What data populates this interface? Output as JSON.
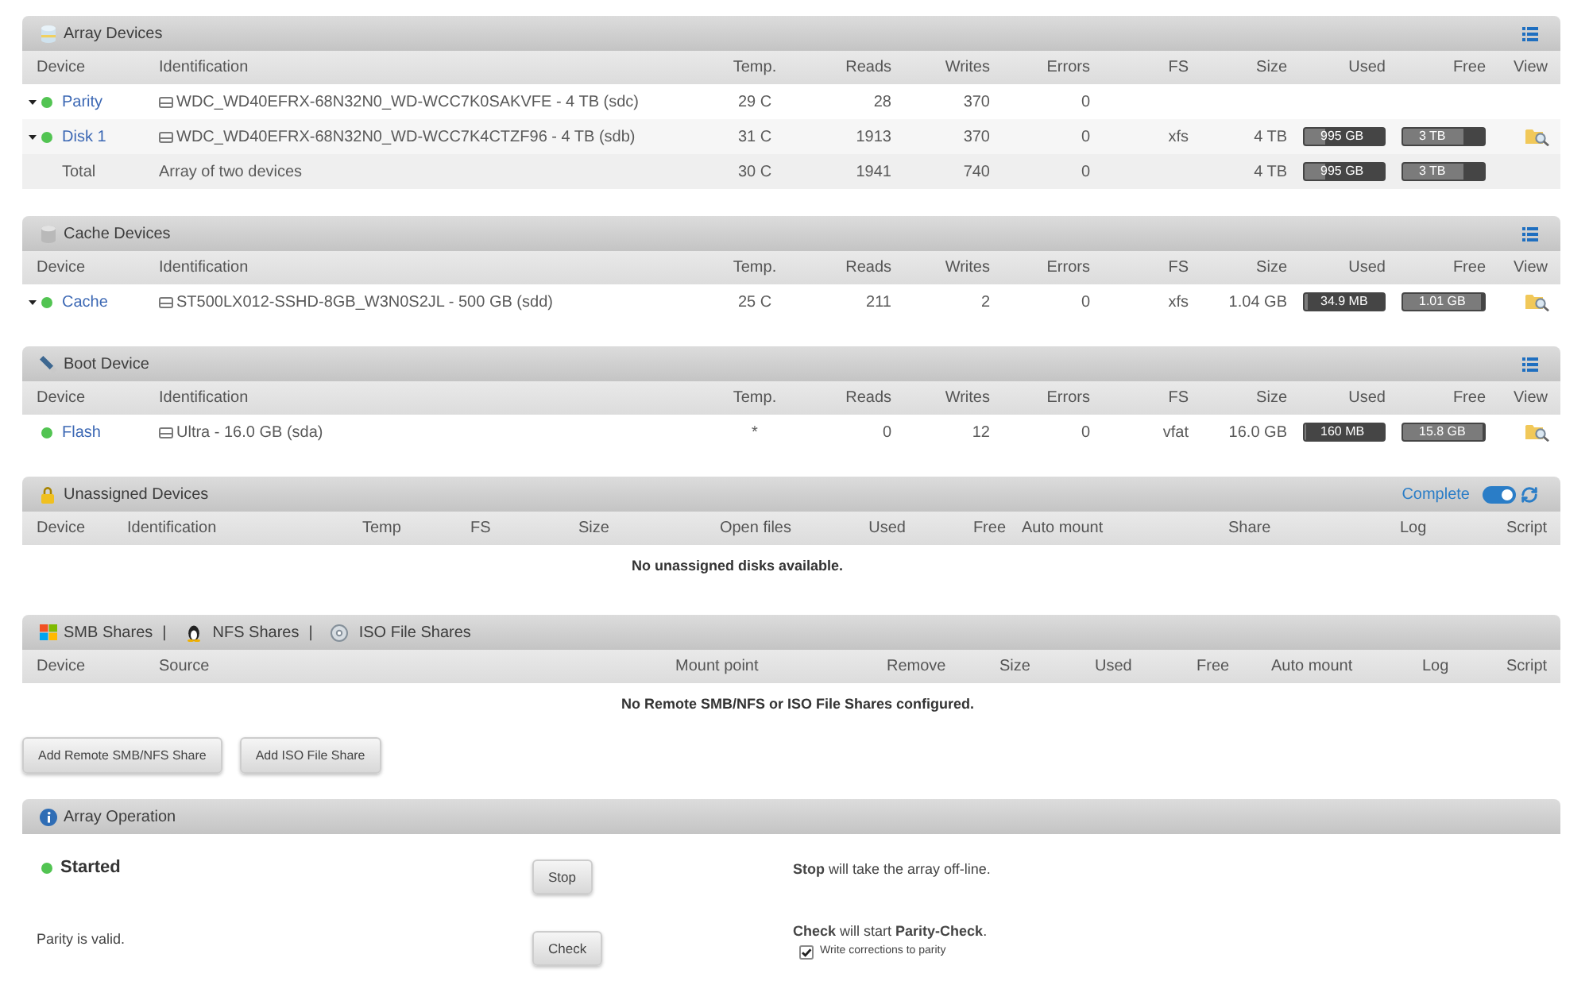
{
  "array_devices": {
    "title": "Array Devices",
    "columns": [
      "Device",
      "Identification",
      "Temp.",
      "Reads",
      "Writes",
      "Errors",
      "FS",
      "Size",
      "Used",
      "Free",
      "View"
    ],
    "rows": [
      {
        "kind": "device",
        "dropdown": true,
        "viewable": false,
        "name": "Parity",
        "identification": "WDC_WD40EFRX-68N32N0_WD-WCC7K0SAKVFE - 4 TB (sdc)",
        "temp": "29 C",
        "reads": "28",
        "writes": "370",
        "errors": "0"
      },
      {
        "kind": "device",
        "dropdown": true,
        "viewable": true,
        "name": "Disk 1",
        "identification": "WDC_WD40EFRX-68N32N0_WD-WCC7K4CTZF96 - 4 TB (sdb)",
        "temp": "31 C",
        "reads": "1913",
        "writes": "370",
        "errors": "0",
        "fs": "xfs",
        "size": "4 TB",
        "used": {
          "text": "995 GB",
          "level": 0.25
        },
        "free": {
          "text": "3 TB",
          "level": 0.75
        }
      },
      {
        "kind": "total",
        "dropdown": false,
        "viewable": false,
        "name": "Total",
        "identification": "Array of two devices",
        "temp": "30 C",
        "reads": "1941",
        "writes": "740",
        "errors": "0",
        "size": "4 TB",
        "used": {
          "text": "995 GB",
          "level": 0.25
        },
        "free": {
          "text": "3 TB",
          "level": 0.75
        }
      }
    ]
  },
  "cache_devices": {
    "title": "Cache Devices",
    "columns": [
      "Device",
      "Identification",
      "Temp.",
      "Reads",
      "Writes",
      "Errors",
      "FS",
      "Size",
      "Used",
      "Free",
      "View"
    ],
    "rows": [
      {
        "kind": "device",
        "dropdown": true,
        "viewable": true,
        "name": "Cache",
        "identification": "ST500LX012-SSHD-8GB_W3N0S2JL - 500 GB (sdd)",
        "temp": "25 C",
        "reads": "211",
        "writes": "2",
        "errors": "0",
        "fs": "xfs",
        "size": "1.04 GB",
        "used": {
          "text": "34.9 MB",
          "level": 0.03
        },
        "free": {
          "text": "1.01 GB",
          "level": 0.97
        }
      }
    ]
  },
  "boot_device": {
    "title": "Boot Device",
    "columns": [
      "Device",
      "Identification",
      "Temp.",
      "Reads",
      "Writes",
      "Errors",
      "FS",
      "Size",
      "Used",
      "Free",
      "View"
    ],
    "rows": [
      {
        "kind": "device",
        "dropdown": false,
        "viewable": true,
        "name": "Flash",
        "identification": "Ultra - 16.0 GB (sda)",
        "temp": "*",
        "reads": "0",
        "writes": "12",
        "errors": "0",
        "fs": "vfat",
        "size": "16.0 GB",
        "used": {
          "text": "160 MB",
          "level": 0.01
        },
        "free": {
          "text": "15.8 GB",
          "level": 0.98
        }
      }
    ]
  },
  "unassigned_devices": {
    "title": "Unassigned Devices",
    "toggle": {
      "label": "Complete",
      "on": true
    },
    "columns": [
      "Device",
      "Identification",
      "Temp",
      "FS",
      "Size",
      "Open files",
      "Used",
      "Free",
      "Auto mount",
      "Share",
      "Log",
      "Script"
    ],
    "message": "No unassigned disks available."
  },
  "remote_shares": {
    "title_parts": [
      {
        "kind": "label",
        "text": "SMB Shares"
      },
      {
        "kind": "separator",
        "text": "|"
      },
      {
        "kind": "label",
        "text": "NFS Shares"
      },
      {
        "kind": "separator",
        "text": "|"
      },
      {
        "kind": "label",
        "text": "ISO File Shares"
      }
    ],
    "columns": [
      "Device",
      "Source",
      "Mount point",
      "Remove",
      "Size",
      "Used",
      "Free",
      "Auto mount",
      "Log",
      "Script"
    ],
    "message": "No Remote SMB/NFS or ISO File Shares configured.",
    "buttons": [
      "Add Remote SMB/NFS Share",
      "Add ISO File Share"
    ]
  },
  "array_operation": {
    "title": "Array Operation",
    "rows": [
      {
        "kind": "status",
        "status": "Started",
        "button": "Stop",
        "description": "**Stop** will take the array off-line."
      },
      {
        "kind": "note",
        "status": "Parity is valid.",
        "button": "Check",
        "description": "**Check** will start **Parity-Check**.",
        "option": {
          "label": "Write corrections to parity",
          "checked": true
        }
      }
    ]
  }
}
